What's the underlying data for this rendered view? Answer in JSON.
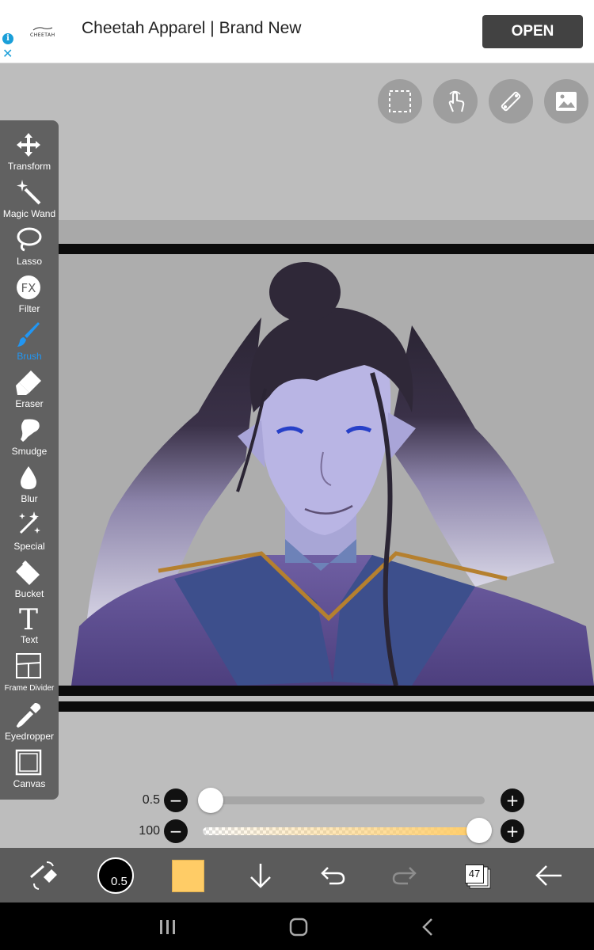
{
  "ad": {
    "info_icon": "info-icon",
    "close_icon": "close-icon",
    "brand_logo_text": "CHEETAH",
    "title": "Cheetah Apparel | Brand New",
    "cta": "OPEN"
  },
  "top_tools": [
    {
      "name": "selection-icon"
    },
    {
      "name": "touch-icon"
    },
    {
      "name": "ruler-icon"
    },
    {
      "name": "image-icon"
    }
  ],
  "tools": [
    {
      "id": "transform",
      "label": "Transform",
      "icon": "move-icon"
    },
    {
      "id": "magic-wand",
      "label": "Magic Wand",
      "icon": "magic-wand-icon"
    },
    {
      "id": "lasso",
      "label": "Lasso",
      "icon": "lasso-icon"
    },
    {
      "id": "filter",
      "label": "Filter",
      "icon": "fx-icon"
    },
    {
      "id": "brush",
      "label": "Brush",
      "icon": "brush-icon",
      "active": true
    },
    {
      "id": "eraser",
      "label": "Eraser",
      "icon": "eraser-icon"
    },
    {
      "id": "smudge",
      "label": "Smudge",
      "icon": "smudge-icon"
    },
    {
      "id": "blur",
      "label": "Blur",
      "icon": "drop-icon"
    },
    {
      "id": "special",
      "label": "Special",
      "icon": "sparkle-icon"
    },
    {
      "id": "bucket",
      "label": "Bucket",
      "icon": "bucket-icon"
    },
    {
      "id": "text",
      "label": "Text",
      "icon": "text-icon"
    },
    {
      "id": "frame-divider",
      "label": "Frame Divider",
      "icon": "frame-divider-icon"
    },
    {
      "id": "eyedropper",
      "label": "Eyedropper",
      "icon": "eyedropper-icon"
    },
    {
      "id": "canvas",
      "label": "Canvas",
      "icon": "canvas-icon"
    }
  ],
  "filter_glyph": "FX",
  "text_glyph": "T",
  "sliders": {
    "size": {
      "label": "0.5",
      "value": 0.5,
      "fraction": 0.0
    },
    "opacity": {
      "label": "100",
      "value": 100,
      "fraction": 1.0
    }
  },
  "bottom": {
    "brush_size": "0.5",
    "color": "#ffcc66",
    "layers": "47"
  },
  "colors": {
    "accent": "#2196f3",
    "toolbar": "#616161",
    "bottom_bar": "#5b5b5b"
  }
}
